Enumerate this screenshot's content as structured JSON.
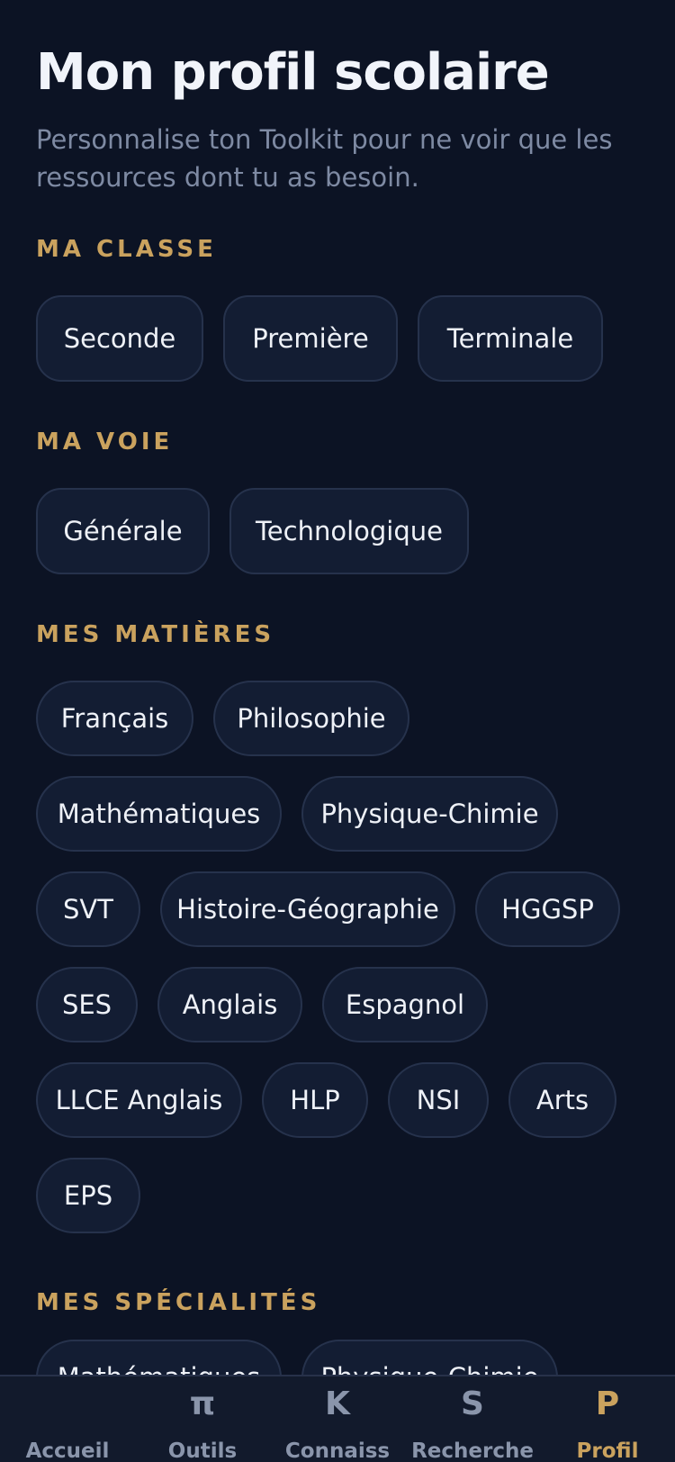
{
  "page": {
    "title": "Mon profil scolaire",
    "subtitle": "Personnalise ton Toolkit pour ne voir que les ressources dont tu as besoin."
  },
  "sections": {
    "classe": {
      "label": "MA CLASSE",
      "options": [
        "Seconde",
        "Première",
        "Terminale"
      ]
    },
    "voie": {
      "label": "MA VOIE",
      "options": [
        "Générale",
        "Technologique"
      ]
    },
    "matieres": {
      "label": "MES MATIÈRES",
      "options": [
        "Français",
        "Philosophie",
        "Mathématiques",
        "Physique-Chimie",
        "SVT",
        "Histoire-Géographie",
        "HGGSP",
        "SES",
        "Anglais",
        "Espagnol",
        "LLCE Anglais",
        "HLP",
        "NSI",
        "Arts",
        "EPS"
      ]
    },
    "specialites": {
      "label": "MES SPÉCIALITÉS",
      "options": [
        "Mathématiques",
        "Physique-Chimie"
      ]
    }
  },
  "nav": {
    "items": [
      {
        "icon": "",
        "label": "Accueil"
      },
      {
        "icon": "π",
        "label": "Outils"
      },
      {
        "icon": "K",
        "label": "Connaiss"
      },
      {
        "icon": "S",
        "label": "Recherche"
      },
      {
        "icon": "P",
        "label": "Profil"
      }
    ],
    "active": "Profil"
  },
  "colors": {
    "background": "#0c1324",
    "accent": "#caa25e",
    "chip_bg": "#131d33",
    "chip_border": "#26324c"
  }
}
